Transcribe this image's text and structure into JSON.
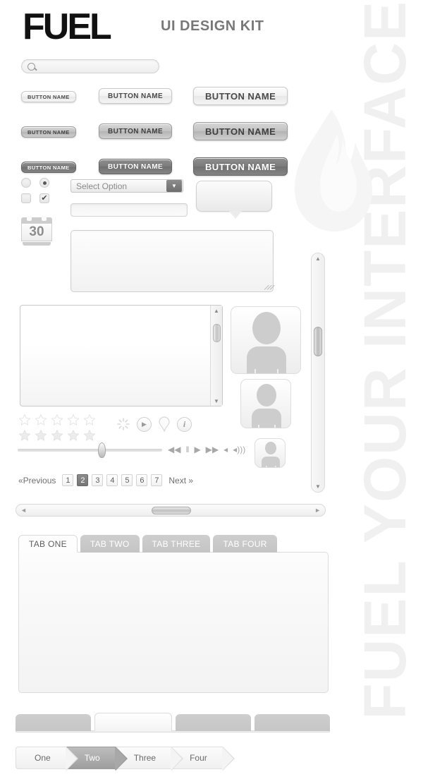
{
  "brand": {
    "logo": "FUEL",
    "kit_title": "UI DESIGN KIT",
    "watermark": "FUEL YOUR INTERFACE"
  },
  "search": {
    "placeholder": "",
    "value": "",
    "icon": "search-icon"
  },
  "buttons": {
    "label": "BUTTON NAME",
    "rows": [
      {
        "style": "light",
        "items": [
          "BUTTON NAME",
          "BUTTON NAME",
          "BUTTON NAME"
        ]
      },
      {
        "style": "mid",
        "items": [
          "BUTTON NAME",
          "BUTTON NAME",
          "BUTTON NAME"
        ]
      },
      {
        "style": "dark",
        "items": [
          "BUTTON NAME",
          "BUTTON NAME",
          "BUTTON NAME"
        ]
      }
    ]
  },
  "form": {
    "radio_off": "",
    "radio_on": "",
    "checkbox_off": "",
    "checkbox_on": "✔",
    "select": {
      "value": "Select Option",
      "arrow": "▼"
    },
    "text_input": {
      "value": "",
      "placeholder": ""
    },
    "textarea": {
      "value": "",
      "placeholder": ""
    },
    "calendar": {
      "day": "30"
    },
    "tooltip": {
      "text": ""
    }
  },
  "scroll_panel": {
    "up": "▲",
    "down": "▼"
  },
  "scrollbar_vertical": {
    "up": "▲",
    "down": "▼"
  },
  "scrollbar_horizontal": {
    "left": "◄",
    "right": "►"
  },
  "rating": {
    "outline_count": 5,
    "filled_count": 5,
    "outline_glyph": "☆",
    "filled_glyph": "★"
  },
  "icons": {
    "spinner": "spinner-icon",
    "play": "▶",
    "pin": "map-pin-icon",
    "info": "i"
  },
  "slider": {
    "value_percent": 58
  },
  "media_controls": [
    {
      "name": "rewind",
      "glyph": "◀◀"
    },
    {
      "name": "pause",
      "glyph": "‖"
    },
    {
      "name": "play",
      "glyph": "▶"
    },
    {
      "name": "fast-forward",
      "glyph": "▶▶"
    },
    {
      "name": "mute",
      "glyph": "◂"
    },
    {
      "name": "volume",
      "glyph": "◂)))"
    }
  ],
  "pagination": {
    "previous": "«Previous",
    "next": "Next »",
    "pages": [
      "1",
      "2",
      "3",
      "4",
      "5",
      "6",
      "7"
    ],
    "active_page": "2"
  },
  "tabs": {
    "items": [
      "TAB ONE",
      "TAB TWO",
      "TAB THREE",
      "TAB FOUR"
    ],
    "active_index": 0,
    "panel_content": ""
  },
  "bottom_tabs": {
    "count": 4,
    "active_index": 1
  },
  "breadcrumb": {
    "items": [
      "One",
      "Two",
      "Three",
      "Four"
    ],
    "active_index": 1
  }
}
